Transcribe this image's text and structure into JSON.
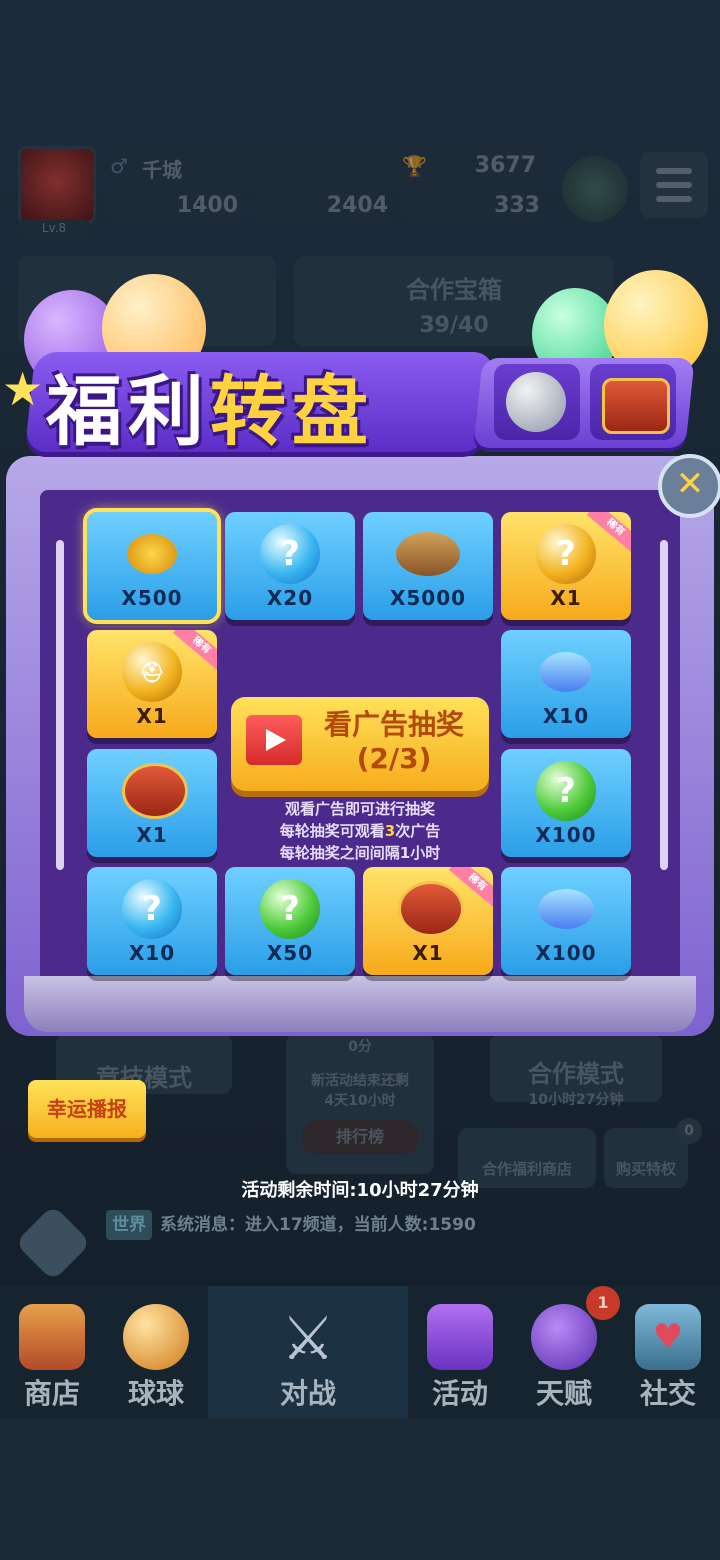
{
  "hud": {
    "player_name": "千城",
    "trophies": "3677",
    "level": "Lv.8",
    "currency_1": "1400",
    "currency_2": "2404",
    "currency_3": "333"
  },
  "background_panels": {
    "coop_chest_title": "合作宝箱",
    "coop_chest_progress": "39/40",
    "competitive_mode": "竞技模式",
    "coop_mode": "合作模式",
    "coop_mode_timer": "10小时27分钟",
    "event_countdown_line1": "新活动结束还剩",
    "event_countdown_line2": "4天10小时",
    "leaderboard": "排行榜",
    "points": "0分",
    "coop_shop": "合作福利商店",
    "buy_privilege": "购买特权",
    "privilege_count": "0"
  },
  "popup": {
    "title_part1": "福利",
    "title_part2": "转盘",
    "close": "✕",
    "rare_tag": "稀有",
    "ad_button_line1": "看广告抽奖",
    "ad_button_line2": "(2/3)",
    "rule_1": "观看广告即可进行抽奖",
    "rule_2_pre": "每轮抽奖可观看",
    "rule_2_num": "3",
    "rule_2_post": "次广告",
    "rule_3": "每轮抽奖之间间隔1小时",
    "prizes": [
      {
        "icon": "coins-icon",
        "qty": "X500"
      },
      {
        "icon": "blue-orb-icon",
        "qty": "X20"
      },
      {
        "icon": "treasure-chest-icon",
        "qty": "X5000"
      },
      {
        "icon": "gold-orb-icon",
        "qty": "X1"
      },
      {
        "icon": "gem-icon",
        "qty": "X10"
      },
      {
        "icon": "green-orb-icon",
        "qty": "X100"
      },
      {
        "icon": "gem-icon",
        "qty": "X100"
      },
      {
        "icon": "red-chest-icon",
        "qty": "X1"
      },
      {
        "icon": "green-orb-icon",
        "qty": "X50"
      },
      {
        "icon": "blue-orb-icon",
        "qty": "X10"
      },
      {
        "icon": "red-chest-icon",
        "qty": "X1"
      },
      {
        "icon": "gold-helmet-icon",
        "qty": "X1"
      }
    ],
    "selected_prize": "X500"
  },
  "lucky_broadcast": "幸运播报",
  "event_timer": "活动剩余时间:10小时27分钟",
  "chat": {
    "channel": "世界",
    "message": "系统消息：进入17频道，当前人数:1590"
  },
  "nav": {
    "shop": "商店",
    "balls": "球球",
    "battle": "对战",
    "events": "活动",
    "talent": "天赋",
    "social": "社交",
    "talent_badge": "1"
  },
  "colors": {
    "popup_purple": "#5b2ec7",
    "cell_blue": "#2a9ee8",
    "cell_gold": "#f7a91a",
    "accent_yellow": "#ffd23f"
  }
}
